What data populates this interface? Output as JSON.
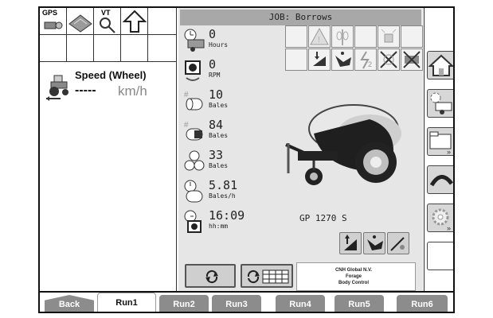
{
  "status_bar": {
    "gps_label": "GPS",
    "vt_label": "VT"
  },
  "speed": {
    "title": "Speed (Wheel)",
    "value": "-----",
    "unit": "km/h"
  },
  "job": {
    "label": "JOB:  Borrows"
  },
  "counters": [
    {
      "name": "hours",
      "value": "0",
      "unit": "Hours"
    },
    {
      "name": "rpm",
      "value": "0",
      "unit": "RPM"
    },
    {
      "name": "bales-total",
      "value": "10",
      "unit": "Bales"
    },
    {
      "name": "bales-wrapped",
      "value": "84",
      "unit": "Bales"
    },
    {
      "name": "bales-tied",
      "value": "33",
      "unit": "Bales"
    },
    {
      "name": "bales-rate",
      "value": "5.81",
      "unit": "Bales/h"
    },
    {
      "name": "time",
      "value": "16:09",
      "unit": "hh:mm"
    }
  ],
  "machine": {
    "name": "GP 1270 S"
  },
  "manufacturer": {
    "line1": "CNH Global N.V.",
    "line2": "Forage",
    "line3": "Body Control"
  },
  "tabs": [
    "Back",
    "Run1",
    "Run2",
    "Run3",
    "Run4",
    "Run5",
    "Run6"
  ],
  "active_tab": "Run1",
  "icons": {
    "right_column": [
      "home-icon",
      "baler-settings-icon",
      "folder-icon",
      "pickup-icon",
      "gear-icon",
      "empty"
    ],
    "warnings_row1": [
      "empty",
      "warning-triangle-icon",
      "crop-icon",
      "empty",
      "beacon-icon",
      "empty"
    ],
    "warnings_row2": [
      "empty",
      "pickup-down-icon",
      "knife-icon",
      "hydraulic-icon",
      "rotor-off-icon",
      "net-off-icon"
    ]
  }
}
